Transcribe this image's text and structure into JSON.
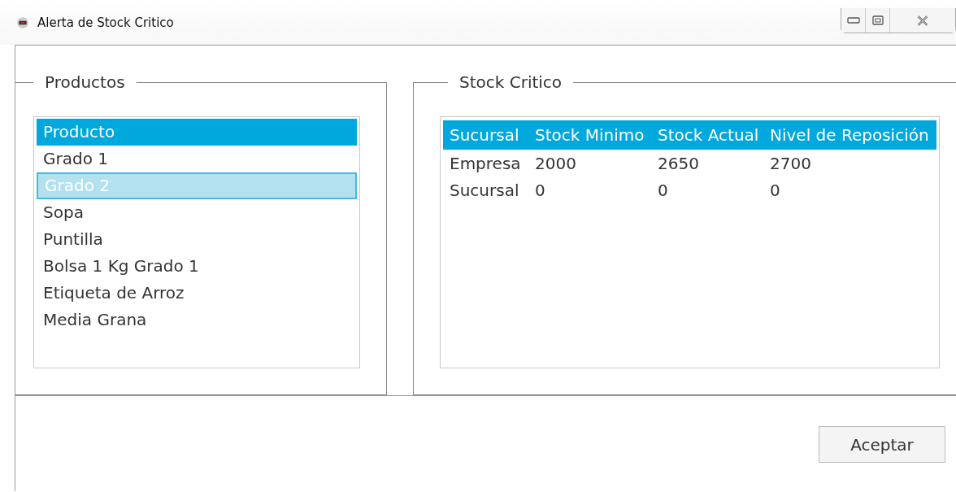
{
  "window": {
    "title": "Alerta de Stock Critico"
  },
  "productos": {
    "title": "Productos",
    "items": [
      {
        "label": "Producto",
        "selected": true,
        "hovered": false
      },
      {
        "label": "Grado 1",
        "selected": false,
        "hovered": false
      },
      {
        "label": "Grado 2",
        "selected": false,
        "hovered": true
      },
      {
        "label": "Sopa",
        "selected": false,
        "hovered": false
      },
      {
        "label": "Puntilla",
        "selected": false,
        "hovered": false
      },
      {
        "label": "Bolsa 1 Kg Grado 1",
        "selected": false,
        "hovered": false
      },
      {
        "label": "Etiqueta de Arroz",
        "selected": false,
        "hovered": false
      },
      {
        "label": "Media Grana",
        "selected": false,
        "hovered": false
      }
    ]
  },
  "stock": {
    "title": "Stock Critico",
    "columns": [
      "Sucursal",
      "Stock Minimo",
      "Stock Actual",
      "Nivel de Reposición"
    ],
    "rows": [
      [
        "Empresa",
        "2000",
        "2650",
        "2700"
      ],
      [
        "Sucursal",
        "0",
        "0",
        "0"
      ]
    ]
  },
  "buttons": [
    "Aceptar"
  ]
}
